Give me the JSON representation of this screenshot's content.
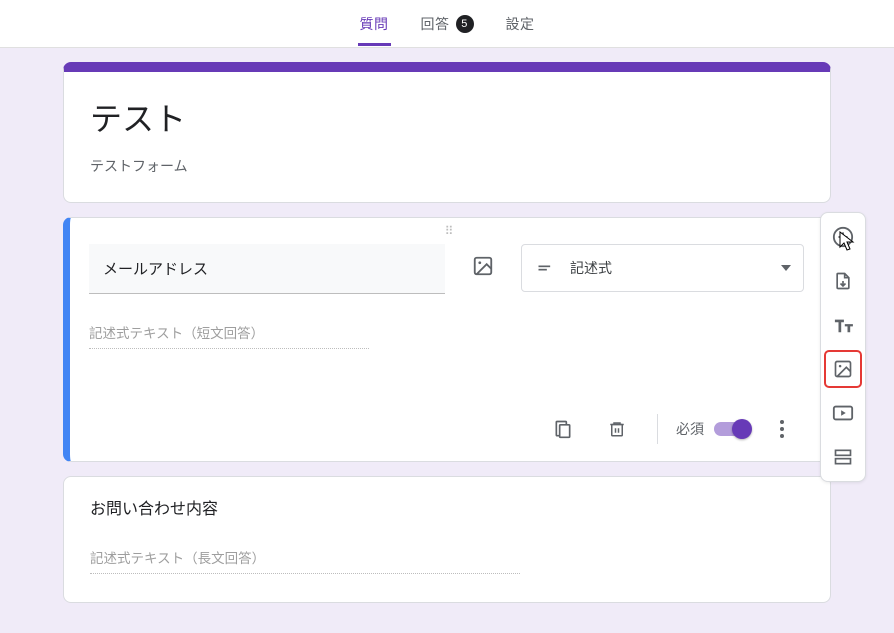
{
  "tabs": {
    "questions": "質問",
    "responses": "回答",
    "responses_count": "5",
    "settings": "設定"
  },
  "form": {
    "title": "テスト",
    "description": "テストフォーム"
  },
  "active_question": {
    "title": "メールアドレス",
    "type_label": "記述式",
    "answer_hint": "記述式テキスト（短文回答）",
    "required_label": "必須"
  },
  "second_question": {
    "title": "お問い合わせ内容",
    "answer_hint": "記述式テキスト（長文回答）"
  },
  "icons": {
    "image": "image-icon",
    "short_text": "short-text-icon",
    "copy": "copy-icon",
    "delete": "delete-icon",
    "more": "more-vert-icon",
    "add_question": "add-circle-icon",
    "import": "import-icon",
    "add_title": "text-title-icon",
    "add_image": "image-icon",
    "add_video": "video-icon",
    "add_section": "section-icon"
  }
}
